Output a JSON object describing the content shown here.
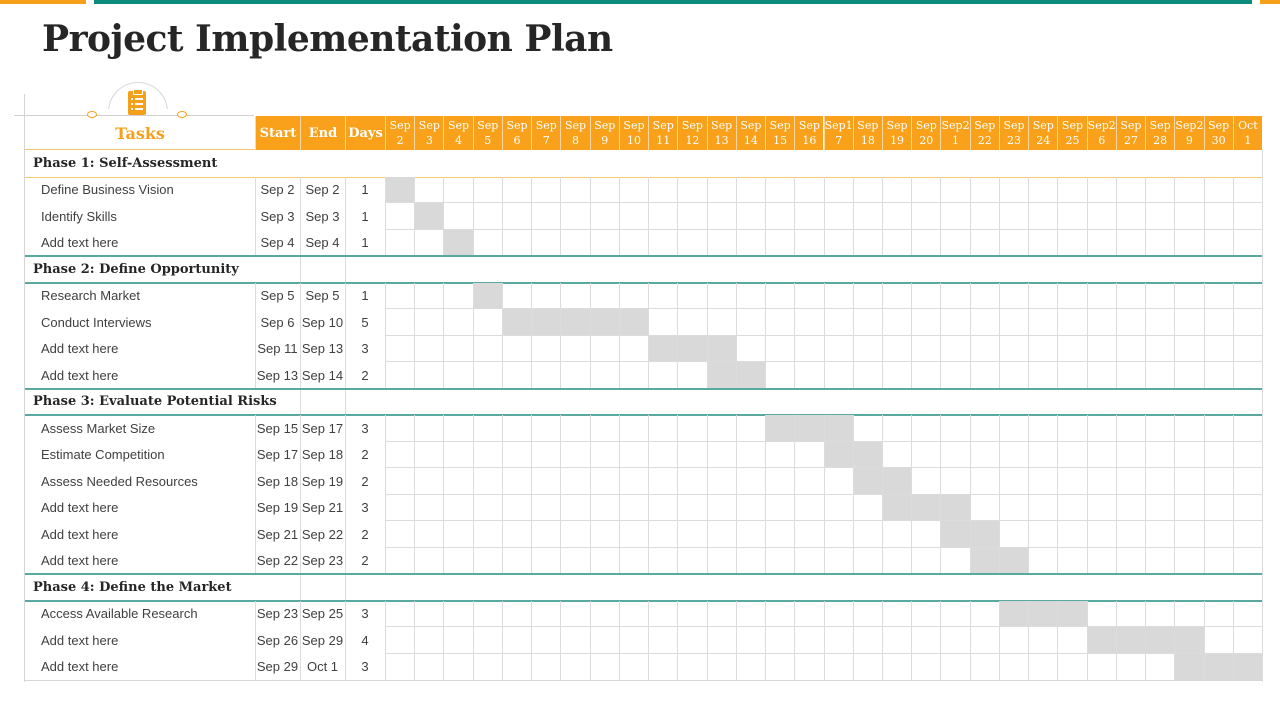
{
  "title": "Project Implementation Plan",
  "colors": {
    "accent": "#f9a11b",
    "teal": "#0e8a7a",
    "bar": "#d9d9d9"
  },
  "header": {
    "tasks_label": "Tasks",
    "tasks_icon": "clipboard-checklist-icon",
    "start_label": "Start",
    "end_label": "End",
    "days_label": "Days",
    "day_columns": [
      "Sep\n2",
      "Sep\n3",
      "Sep\n4",
      "Sep\n5",
      "Sep\n6",
      "Sep\n7",
      "Sep\n8",
      "Sep\n9",
      "Sep\n10",
      "Sep\n11",
      "Sep\n12",
      "Sep\n13",
      "Sep\n14",
      "Sep\n15",
      "Sep\n16",
      "Sep1\n7",
      "Sep\n18",
      "Sep\n19",
      "Sep\n20",
      "Sep2\n1",
      "Sep\n22",
      "Sep\n23",
      "Sep\n24",
      "Sep\n25",
      "Sep2\n6",
      "Sep\n27",
      "Sep\n28",
      "Sep2\n9",
      "Sep\n30",
      "Oct\n1"
    ]
  },
  "phases": [
    {
      "name": "Phase 1: Self-Assessment",
      "tasks": [
        {
          "name": "Define  Business Vision",
          "start": "Sep 2",
          "end": "Sep 2",
          "days": "1",
          "start_index": 0,
          "duration": 1
        },
        {
          "name": "Identify  Skills",
          "start": "Sep 3",
          "end": "Sep 3",
          "days": "1",
          "start_index": 1,
          "duration": 1
        },
        {
          "name": "Add text here",
          "start": "Sep 4",
          "end": "Sep 4",
          "days": "1",
          "start_index": 2,
          "duration": 1
        }
      ]
    },
    {
      "name": "Phase 2: Define Opportunity",
      "tasks": [
        {
          "name": "Research  Market",
          "start": "Sep 5",
          "end": "Sep 5",
          "days": "1",
          "start_index": 3,
          "duration": 1
        },
        {
          "name": "Conduct  Interviews",
          "start": "Sep 6",
          "end": "Sep 10",
          "days": "5",
          "start_index": 4,
          "duration": 5
        },
        {
          "name": "Add text here",
          "start": "Sep 11",
          "end": "Sep 13",
          "days": "3",
          "start_index": 9,
          "duration": 3
        },
        {
          "name": "Add text here",
          "start": "Sep 13",
          "end": "Sep 14",
          "days": "2",
          "start_index": 11,
          "duration": 2
        }
      ]
    },
    {
      "name": "Phase 3: Evaluate  Potential  Risks",
      "tasks": [
        {
          "name": "Assess Market Size",
          "start": "Sep 15",
          "end": "Sep 17",
          "days": "3",
          "start_index": 13,
          "duration": 3
        },
        {
          "name": "Estimate Competition",
          "start": "Sep 17",
          "end": "Sep 18",
          "days": "2",
          "start_index": 15,
          "duration": 2
        },
        {
          "name": "Assess Needed  Resources",
          "start": "Sep 18",
          "end": "Sep 19",
          "days": "2",
          "start_index": 16,
          "duration": 2
        },
        {
          "name": "Add text here",
          "start": "Sep 19",
          "end": "Sep 21",
          "days": "3",
          "start_index": 17,
          "duration": 3
        },
        {
          "name": "Add text here",
          "start": "Sep 21",
          "end": "Sep 22",
          "days": "2",
          "start_index": 19,
          "duration": 2
        },
        {
          "name": "Add text here",
          "start": "Sep 22",
          "end": "Sep 23",
          "days": "2",
          "start_index": 20,
          "duration": 2
        }
      ]
    },
    {
      "name": "Phase 4: Define the Market",
      "tasks": [
        {
          "name": "Access Available  Research",
          "start": "Sep 23",
          "end": "Sep 25",
          "days": "3",
          "start_index": 21,
          "duration": 3
        },
        {
          "name": "Add text here",
          "start": "Sep 26",
          "end": "Sep 29",
          "days": "4",
          "start_index": 24,
          "duration": 4
        },
        {
          "name": "Add text here",
          "start": "Sep 29",
          "end": "Oct 1",
          "days": "3",
          "start_index": 27,
          "duration": 3
        }
      ]
    }
  ]
}
